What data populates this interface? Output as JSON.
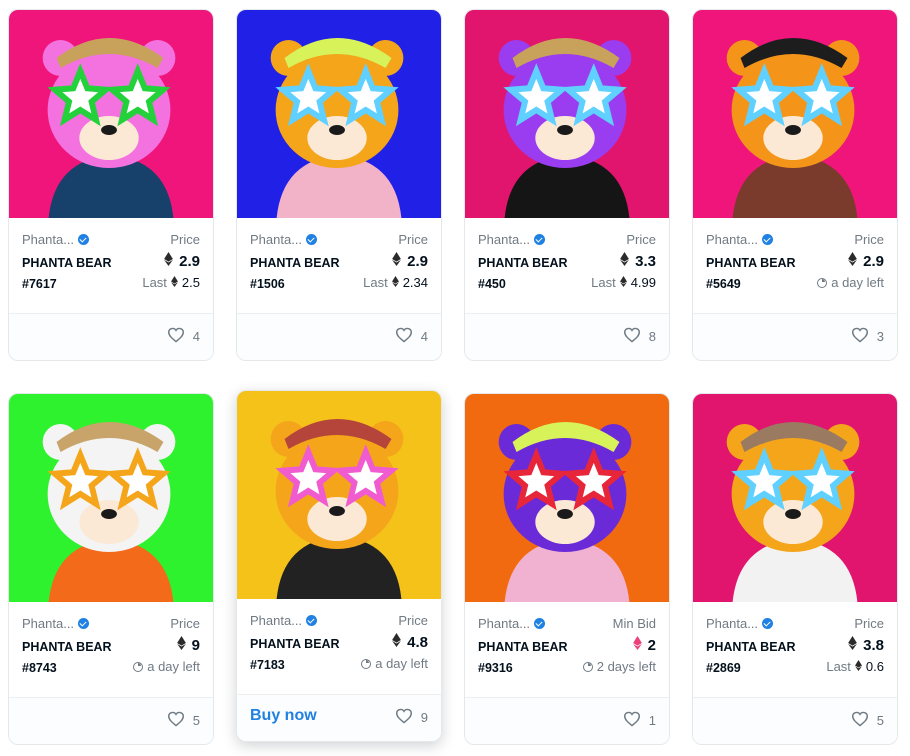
{
  "colors": {
    "accent": "#2081e2",
    "muted": "#707a83",
    "text": "#04111d"
  },
  "cards": [
    {
      "collection": "Phanta...",
      "name": "PHANTA BEAR #7617",
      "price_label": "Price",
      "price": "2.9",
      "secondary_type": "last",
      "secondary_label": "Last",
      "secondary_value": "2.5",
      "likes": "4",
      "bg": "#f0157b",
      "head": "#f472e0",
      "hat": "#c8a25a",
      "star": "#23d13a",
      "shirt": "#17406a"
    },
    {
      "collection": "Phanta...",
      "name": "PHANTA BEAR #1506",
      "price_label": "Price",
      "price": "2.9",
      "secondary_type": "last",
      "secondary_label": "Last",
      "secondary_value": "2.34",
      "likes": "4",
      "bg": "#2020e6",
      "head": "#f4a51a",
      "hat": "#d8f25a",
      "star": "#5fd0ff",
      "shirt": "#f2b2c8"
    },
    {
      "collection": "Phanta...",
      "name": "PHANTA BEAR #450",
      "price_label": "Price",
      "price": "3.3",
      "secondary_type": "last",
      "secondary_label": "Last",
      "secondary_value": "4.99",
      "likes": "8",
      "bg": "#e2156e",
      "head": "#9a3cf0",
      "hat": "#c8a25a",
      "star": "#5fd0ff",
      "shirt": "#151515"
    },
    {
      "collection": "Phanta...",
      "name": "PHANTA BEAR #5649",
      "price_label": "Price",
      "price": "2.9",
      "secondary_type": "time",
      "secondary_value": "a day left",
      "likes": "3",
      "bg": "#f0157b",
      "head": "#f4951a",
      "hat": "#1d1d1d",
      "star": "#5fd0ff",
      "shirt": "#7a3a2c"
    },
    {
      "collection": "Phanta...",
      "name": "PHANTA BEAR #8743",
      "price_label": "Price",
      "price": "9",
      "secondary_type": "time",
      "secondary_value": "a day left",
      "likes": "5",
      "bg": "#2ef22e",
      "head": "#f4f4f4",
      "hat": "#c9a46a",
      "star": "#f4a51a",
      "shirt": "#f26a1a"
    },
    {
      "collection": "Phanta...",
      "name": "PHANTA BEAR #7183",
      "price_label": "Price",
      "price": "4.8",
      "secondary_type": "time",
      "secondary_value": "a day left",
      "likes": "9",
      "buy_label": "Buy now",
      "bg": "#f5c21a",
      "head": "#f4a51a",
      "hat": "#b5453a",
      "star": "#f05cd0",
      "shirt": "#222222"
    },
    {
      "collection": "Phanta...",
      "name": "PHANTA BEAR #9316",
      "price_label": "Min Bid",
      "price": "2",
      "price_currency": "weth",
      "secondary_type": "time",
      "secondary_value": "2 days left",
      "likes": "1",
      "bg": "#f26a10",
      "head": "#6a2ad8",
      "hat": "#d8f25a",
      "star": "#e8263a",
      "shirt": "#f0b2d0"
    },
    {
      "collection": "Phanta...",
      "name": "PHANTA BEAR #2869",
      "price_label": "Price",
      "price": "3.8",
      "secondary_type": "last",
      "secondary_label": "Last",
      "secondary_value": "0.6",
      "likes": "5",
      "bg": "#e2156e",
      "head": "#f4a51a",
      "hat": "#9a7a60",
      "star": "#5fd0ff",
      "shirt": "#f2f2f2"
    }
  ]
}
